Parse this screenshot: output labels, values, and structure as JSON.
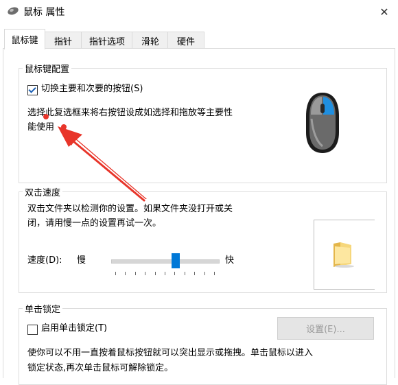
{
  "window": {
    "title": "鼠标 属性",
    "close_glyph": "✕"
  },
  "tabs": [
    {
      "label": "鼠标键",
      "active": true
    },
    {
      "label": "指针",
      "active": false
    },
    {
      "label": "指针选项",
      "active": false
    },
    {
      "label": "滑轮",
      "active": false
    },
    {
      "label": "硬件",
      "active": false
    }
  ],
  "button_config": {
    "title": "鼠标键配置",
    "switch_checkbox_label": "切换主要和次要的按钮(S)",
    "switch_checked": true,
    "description_line1": "选择此复选框来将右按钮设成如选择和拖放等主要性",
    "description_line2": "能使用"
  },
  "double_click": {
    "title": "双击速度",
    "description_line1": "双击文件夹以检测你的设置。如果文件夹没打开或关",
    "description_line2": "闭，请用慢一点的设置再试一次。",
    "speed_label": "速度(D):",
    "slow_label": "慢",
    "fast_label": "快",
    "speed_fraction": 0.6
  },
  "click_lock": {
    "title": "单击锁定",
    "checkbox_label": "启用单击锁定(T)",
    "checked": false,
    "settings_button": "设置(E)...",
    "description_line1": "使你可以不用一直按着鼠标按钮就可以突出显示或拖拽。单击鼠标以进入",
    "description_line2": "锁定状态,再次单击鼠标可解除锁定。"
  },
  "colors": {
    "accent": "#0078d7",
    "arrow": "#e8352a",
    "mouse_highlight": "#1f8fe0"
  },
  "icons": {
    "window_icon": "mouse-icon",
    "mouse_illustration": "mouse-illustration-icon",
    "test_folder": "folder-icon"
  }
}
